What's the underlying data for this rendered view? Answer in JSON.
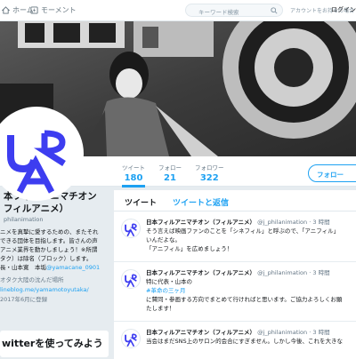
{
  "nav": {
    "home": "ホーム",
    "moments": "モーメント",
    "search_placeholder": "キーワード検索",
    "no_account": "アカウントをお持ちの場合",
    "login": "ログイン"
  },
  "stats": [
    {
      "label": "ツイート",
      "value": "180"
    },
    {
      "label": "フォロー",
      "value": "21"
    },
    {
      "label": "フォロワー",
      "value": "322"
    }
  ],
  "follow_button": "フォロー",
  "profile": {
    "name_line1": "本フィルアニマチオン",
    "name_line2": "フィルアニメ）",
    "handle": "philanimation",
    "bio_line1": "ニメを真摯に愛するための、またそれ",
    "bio_line2": "できる団体を目指します。皆さんの声",
    "bio_line3": "アニメ業界を動かしましょう！※所謂",
    "bio_line4": "タク）は除名（ブロック）します。",
    "bio_line5_text": "長・山本寛　本垢",
    "bio_line5_link": "@yamacane_0901",
    "location": "オタク大陸の沈んだ場所",
    "url": "lineblog.me/yamamotoyutaka/",
    "joined": "2017年6月に登録"
  },
  "twitter_card": "witterを使ってみよう",
  "timeline": {
    "tab_tweets": "ツイート",
    "tab_replies": "ツイートと返信",
    "tweets": [
      {
        "name": "日本フィルアニマチオン（フィルアニメ）",
        "handle": "@j_philanimation",
        "time": "· 3 時間",
        "line1": "そう言えば映画ファンのことを「シネフィル」と呼ぶので、「アニフィル」",
        "line2": "いんだよな。",
        "line3": "「アニフィル」を広めましょう！"
      },
      {
        "name": "日本フィルアニマチオン（フィルアニメ）",
        "handle": "@j_philanimation",
        "time": "· 3 時間",
        "line1": "特に代表・山本の",
        "line2": "#革命の三ヶ月",
        "line3": "に賛同・参画する方向でまとめて行ければと思います。ご協力よろしくお願",
        "line4": "たします！"
      },
      {
        "name": "日本フィルアニマチオン（フィルアニメ）",
        "handle": "@j_philanimation",
        "time": "· 3 時間",
        "line1": "当会はまだSNS上のサロン的会合にすぎません。しかし今後、これを大きな"
      }
    ]
  },
  "colors": {
    "accent": "#1da1f2",
    "logo_blue": "#3d3df0",
    "banner_dark": "#3a3a3a"
  }
}
